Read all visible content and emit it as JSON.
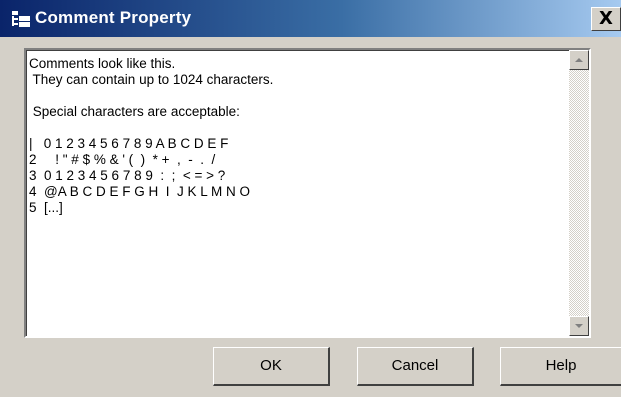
{
  "window": {
    "title": "Comment Property",
    "close_label": "X"
  },
  "editor": {
    "text": "Comments look like this.\n They can contain up to 1024 characters.\n\n Special characters are acceptable:\n\n|   0 1 2 3 4 5 6 7 8 9 A B C D E F\n2     ! \" # $ % & ' (  )  * +  ,  -  .  /\n3  0 1 2 3 4 5 6 7 8 9  :  ;  < = > ?\n4  @A B C D E F G H  I  J K L M N O\n5  [...]"
  },
  "buttons": {
    "ok": "OK",
    "cancel": "Cancel",
    "help": "Help"
  }
}
